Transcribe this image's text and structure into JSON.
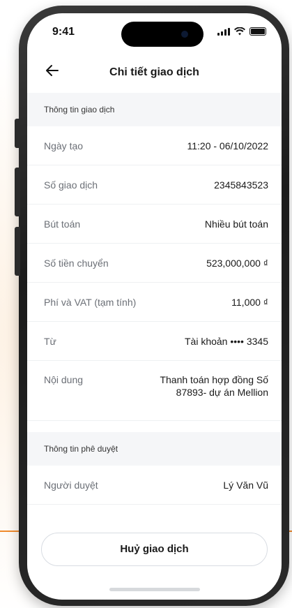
{
  "status_bar": {
    "time": "9:41"
  },
  "header": {
    "title": "Chi tiết giao dịch"
  },
  "sections": [
    {
      "title": "Thông tin giao dịch",
      "rows": [
        {
          "label": "Ngày tạo",
          "value": "11:20 - 06/10/2022"
        },
        {
          "label": "Số giao dịch",
          "value": "2345843523"
        },
        {
          "label": "Bút toán",
          "value": "Nhiều bút toán"
        },
        {
          "label": "Số tiền chuyển",
          "value": "523,000,000 ₫"
        },
        {
          "label": "Phí và VAT (tạm tính)",
          "value": "11,000 ₫"
        },
        {
          "label": "Từ",
          "value": "Tài khoản •••• 3345"
        },
        {
          "label": "Nội dung",
          "value": "Thanh toán hợp đồng Số 87893- dự án Mellion"
        }
      ]
    },
    {
      "title": "Thông tin phê duyệt",
      "rows": [
        {
          "label": "Người duyệt",
          "value": "Lý Văn Vũ"
        }
      ]
    }
  ],
  "actions": {
    "cancel_label": "Huỷ giao dịch"
  },
  "colors": {
    "accent": "#f08a2c",
    "section_bg": "#f5f6f8",
    "label": "#6b6f76"
  }
}
